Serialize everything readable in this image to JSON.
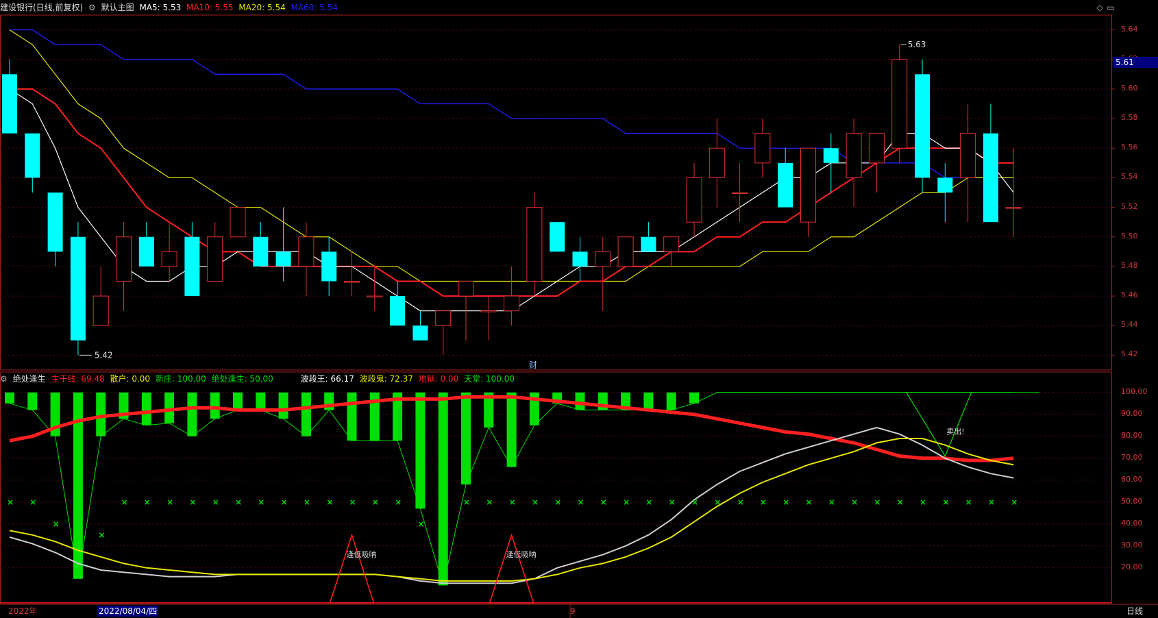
{
  "main_header": {
    "title": "建设银行(日线,前复权)",
    "chart_name": "默认主图",
    "ma5": "MA5: 5.53",
    "ma10": "MA10: 5.55",
    "ma20": "MA20: 5.54",
    "ma60": "MA60: 5.54"
  },
  "indicator_header": {
    "name": "绝处逢生",
    "zhugan": "主干线: 69.48",
    "sanhu": "散户: 0.00",
    "xinzhuang": "新庄: 100.00",
    "juechu": "绝处逢生: 50.00",
    "boduanwang": "波段王: 66.17",
    "boduangui": "波段鬼: 72.37",
    "diyu": "地狱: 0.00",
    "tiantang": "天堂: 100.00"
  },
  "price_axis": {
    "ticks": [
      "5.64",
      "5.62",
      "5.60",
      "5.58",
      "5.56",
      "5.54",
      "5.52",
      "5.50",
      "5.48",
      "5.46",
      "5.44",
      "5.42"
    ],
    "current_price": "5.61"
  },
  "indicator_axis": {
    "ticks": [
      "100.00",
      "90.00",
      "80.00",
      "70.00",
      "60.00",
      "50.00",
      "40.00",
      "30.00",
      "20.00"
    ]
  },
  "annotations": {
    "high": "5.63",
    "low": "5.42",
    "cai": "财",
    "buy1": "逢低吸呐",
    "buy2": "逢低吸呐",
    "sell": "卖出!"
  },
  "bottom": {
    "year": "2022年",
    "date": "2022/08/04/四",
    "month": "9",
    "period": "日线"
  },
  "colors": {
    "up": "#e03030",
    "down": "#00ffff",
    "ma5": "#ffffff",
    "ma10": "#ff2020",
    "ma20": "#e6e600",
    "ma60": "#2020ff",
    "green": "#00e000"
  },
  "chart_data": {
    "type": "candlestick",
    "candles": [
      {
        "o": 5.61,
        "h": 5.62,
        "l": 5.57,
        "c": 5.57
      },
      {
        "o": 5.57,
        "h": 5.57,
        "l": 5.53,
        "c": 5.54
      },
      {
        "o": 5.53,
        "h": 5.53,
        "l": 5.48,
        "c": 5.49
      },
      {
        "o": 5.5,
        "h": 5.51,
        "l": 5.42,
        "c": 5.43
      },
      {
        "o": 5.44,
        "h": 5.48,
        "l": 5.44,
        "c": 5.46
      },
      {
        "o": 5.47,
        "h": 5.51,
        "l": 5.45,
        "c": 5.5
      },
      {
        "o": 5.5,
        "h": 5.51,
        "l": 5.48,
        "c": 5.48
      },
      {
        "o": 5.48,
        "h": 5.51,
        "l": 5.47,
        "c": 5.49
      },
      {
        "o": 5.5,
        "h": 5.51,
        "l": 5.46,
        "c": 5.46
      },
      {
        "o": 5.47,
        "h": 5.51,
        "l": 5.47,
        "c": 5.5
      },
      {
        "o": 5.5,
        "h": 5.52,
        "l": 5.5,
        "c": 5.52
      },
      {
        "o": 5.5,
        "h": 5.51,
        "l": 5.48,
        "c": 5.48
      },
      {
        "o": 5.49,
        "h": 5.52,
        "l": 5.47,
        "c": 5.48
      },
      {
        "o": 5.48,
        "h": 5.51,
        "l": 5.46,
        "c": 5.5
      },
      {
        "o": 5.49,
        "h": 5.5,
        "l": 5.46,
        "c": 5.47
      },
      {
        "o": 5.47,
        "h": 5.49,
        "l": 5.46,
        "c": 5.47
      },
      {
        "o": 5.46,
        "h": 5.48,
        "l": 5.45,
        "c": 5.46
      },
      {
        "o": 5.46,
        "h": 5.47,
        "l": 5.44,
        "c": 5.44
      },
      {
        "o": 5.44,
        "h": 5.45,
        "l": 5.43,
        "c": 5.43
      },
      {
        "o": 5.44,
        "h": 5.45,
        "l": 5.42,
        "c": 5.45
      },
      {
        "o": 5.46,
        "h": 5.47,
        "l": 5.43,
        "c": 5.47
      },
      {
        "o": 5.45,
        "h": 5.46,
        "l": 5.43,
        "c": 5.45
      },
      {
        "o": 5.45,
        "h": 5.48,
        "l": 5.44,
        "c": 5.46
      },
      {
        "o": 5.47,
        "h": 5.53,
        "l": 5.46,
        "c": 5.52
      },
      {
        "o": 5.51,
        "h": 5.51,
        "l": 5.49,
        "c": 5.49
      },
      {
        "o": 5.49,
        "h": 5.5,
        "l": 5.47,
        "c": 5.48
      },
      {
        "o": 5.48,
        "h": 5.5,
        "l": 5.45,
        "c": 5.49
      },
      {
        "o": 5.48,
        "h": 5.5,
        "l": 5.48,
        "c": 5.5
      },
      {
        "o": 5.5,
        "h": 5.51,
        "l": 5.49,
        "c": 5.49
      },
      {
        "o": 5.49,
        "h": 5.5,
        "l": 5.48,
        "c": 5.5
      },
      {
        "o": 5.51,
        "h": 5.55,
        "l": 5.5,
        "c": 5.54
      },
      {
        "o": 5.54,
        "h": 5.58,
        "l": 5.52,
        "c": 5.56
      },
      {
        "o": 5.53,
        "h": 5.55,
        "l": 5.51,
        "c": 5.53
      },
      {
        "o": 5.55,
        "h": 5.58,
        "l": 5.54,
        "c": 5.57
      },
      {
        "o": 5.55,
        "h": 5.56,
        "l": 5.52,
        "c": 5.52
      },
      {
        "o": 5.51,
        "h": 5.56,
        "l": 5.5,
        "c": 5.56
      },
      {
        "o": 5.56,
        "h": 5.57,
        "l": 5.53,
        "c": 5.55
      },
      {
        "o": 5.54,
        "h": 5.58,
        "l": 5.52,
        "c": 5.57
      },
      {
        "o": 5.55,
        "h": 5.57,
        "l": 5.53,
        "c": 5.57
      },
      {
        "o": 5.56,
        "h": 5.63,
        "l": 5.55,
        "c": 5.62
      },
      {
        "o": 5.61,
        "h": 5.62,
        "l": 5.53,
        "c": 5.54
      },
      {
        "o": 5.54,
        "h": 5.55,
        "l": 5.51,
        "c": 5.53
      },
      {
        "o": 5.54,
        "h": 5.59,
        "l": 5.51,
        "c": 5.57
      },
      {
        "o": 5.57,
        "h": 5.59,
        "l": 5.51,
        "c": 5.51
      },
      {
        "o": 5.52,
        "h": 5.56,
        "l": 5.5,
        "c": 5.52
      }
    ],
    "ma5": [
      5.6,
      5.59,
      5.56,
      5.52,
      5.5,
      5.48,
      5.47,
      5.47,
      5.48,
      5.48,
      5.49,
      5.49,
      5.49,
      5.49,
      5.48,
      5.48,
      5.47,
      5.46,
      5.45,
      5.45,
      5.45,
      5.45,
      5.45,
      5.46,
      5.47,
      5.48,
      5.48,
      5.49,
      5.49,
      5.49,
      5.5,
      5.51,
      5.52,
      5.53,
      5.54,
      5.54,
      5.55,
      5.55,
      5.55,
      5.57,
      5.57,
      5.56,
      5.56,
      5.55,
      5.53
    ],
    "ma10": [
      5.6,
      5.6,
      5.59,
      5.57,
      5.56,
      5.54,
      5.52,
      5.51,
      5.5,
      5.49,
      5.49,
      5.48,
      5.48,
      5.48,
      5.48,
      5.48,
      5.48,
      5.47,
      5.47,
      5.46,
      5.46,
      5.46,
      5.46,
      5.46,
      5.46,
      5.47,
      5.47,
      5.48,
      5.48,
      5.49,
      5.49,
      5.5,
      5.5,
      5.51,
      5.51,
      5.52,
      5.53,
      5.54,
      5.55,
      5.56,
      5.56,
      5.56,
      5.56,
      5.55,
      5.55
    ],
    "ma20": [
      5.64,
      5.63,
      5.61,
      5.59,
      5.58,
      5.56,
      5.55,
      5.54,
      5.54,
      5.53,
      5.52,
      5.52,
      5.51,
      5.5,
      5.5,
      5.49,
      5.48,
      5.48,
      5.47,
      5.47,
      5.47,
      5.47,
      5.47,
      5.47,
      5.47,
      5.47,
      5.47,
      5.47,
      5.48,
      5.48,
      5.48,
      5.48,
      5.48,
      5.49,
      5.49,
      5.49,
      5.5,
      5.5,
      5.51,
      5.52,
      5.53,
      5.53,
      5.54,
      5.54,
      5.54
    ],
    "ma60": [
      5.64,
      5.64,
      5.63,
      5.63,
      5.63,
      5.62,
      5.62,
      5.62,
      5.62,
      5.61,
      5.61,
      5.61,
      5.61,
      5.6,
      5.6,
      5.6,
      5.6,
      5.6,
      5.59,
      5.59,
      5.59,
      5.59,
      5.58,
      5.58,
      5.58,
      5.58,
      5.58,
      5.57,
      5.57,
      5.57,
      5.57,
      5.57,
      5.56,
      5.56,
      5.56,
      5.56,
      5.56,
      5.55,
      5.55,
      5.55,
      5.55,
      5.54,
      5.54,
      5.54,
      5.54
    ],
    "indicator": {
      "green_bars_bottom": [
        95,
        92,
        80,
        15,
        80,
        88,
        85,
        86,
        80,
        88,
        92,
        92,
        88,
        80,
        92,
        78,
        78,
        78,
        47,
        12,
        58,
        84,
        66,
        85,
        95,
        92,
        92,
        92,
        92,
        92,
        95,
        100,
        100,
        100,
        100,
        100,
        100,
        100,
        100,
        100,
        100,
        100,
        100,
        100,
        100
      ],
      "zhugan": [
        78,
        80,
        84,
        87,
        89,
        90,
        91,
        92,
        93,
        93,
        92,
        92,
        92,
        93,
        94,
        95,
        96,
        97,
        97,
        97,
        98,
        98,
        98,
        97,
        96,
        95,
        94,
        93,
        92,
        91,
        90,
        88,
        86,
        84,
        82,
        81,
        79,
        77,
        74,
        71,
        70,
        70,
        69,
        69,
        70
      ],
      "white": [
        34,
        31,
        27,
        22,
        19,
        18,
        17,
        16,
        16,
        16,
        17,
        17,
        17,
        17,
        17,
        17,
        17,
        16,
        14,
        13,
        13,
        13,
        13,
        15,
        20,
        23,
        26,
        30,
        35,
        42,
        51,
        58,
        64,
        68,
        72,
        75,
        78,
        81,
        84,
        81,
        76,
        70,
        66,
        63,
        61
      ],
      "yellow": [
        37,
        35,
        32,
        28,
        25,
        22,
        20,
        19,
        18,
        17,
        17,
        17,
        17,
        17,
        17,
        17,
        17,
        16,
        15,
        14,
        14,
        14,
        14,
        15,
        17,
        20,
        22,
        25,
        29,
        34,
        41,
        48,
        54,
        59,
        63,
        67,
        70,
        73,
        77,
        79,
        79,
        76,
        72,
        69,
        67
      ],
      "x_marks": [
        50,
        50,
        40,
        50,
        35,
        50,
        50,
        50,
        50,
        50,
        50,
        50,
        50,
        50,
        50,
        50,
        50,
        50,
        40,
        50,
        50,
        50,
        50,
        50,
        50,
        50,
        50,
        50,
        50,
        50,
        50,
        50,
        50,
        50,
        50,
        50,
        50,
        50,
        50,
        50,
        50,
        50,
        50,
        50,
        50
      ]
    }
  }
}
